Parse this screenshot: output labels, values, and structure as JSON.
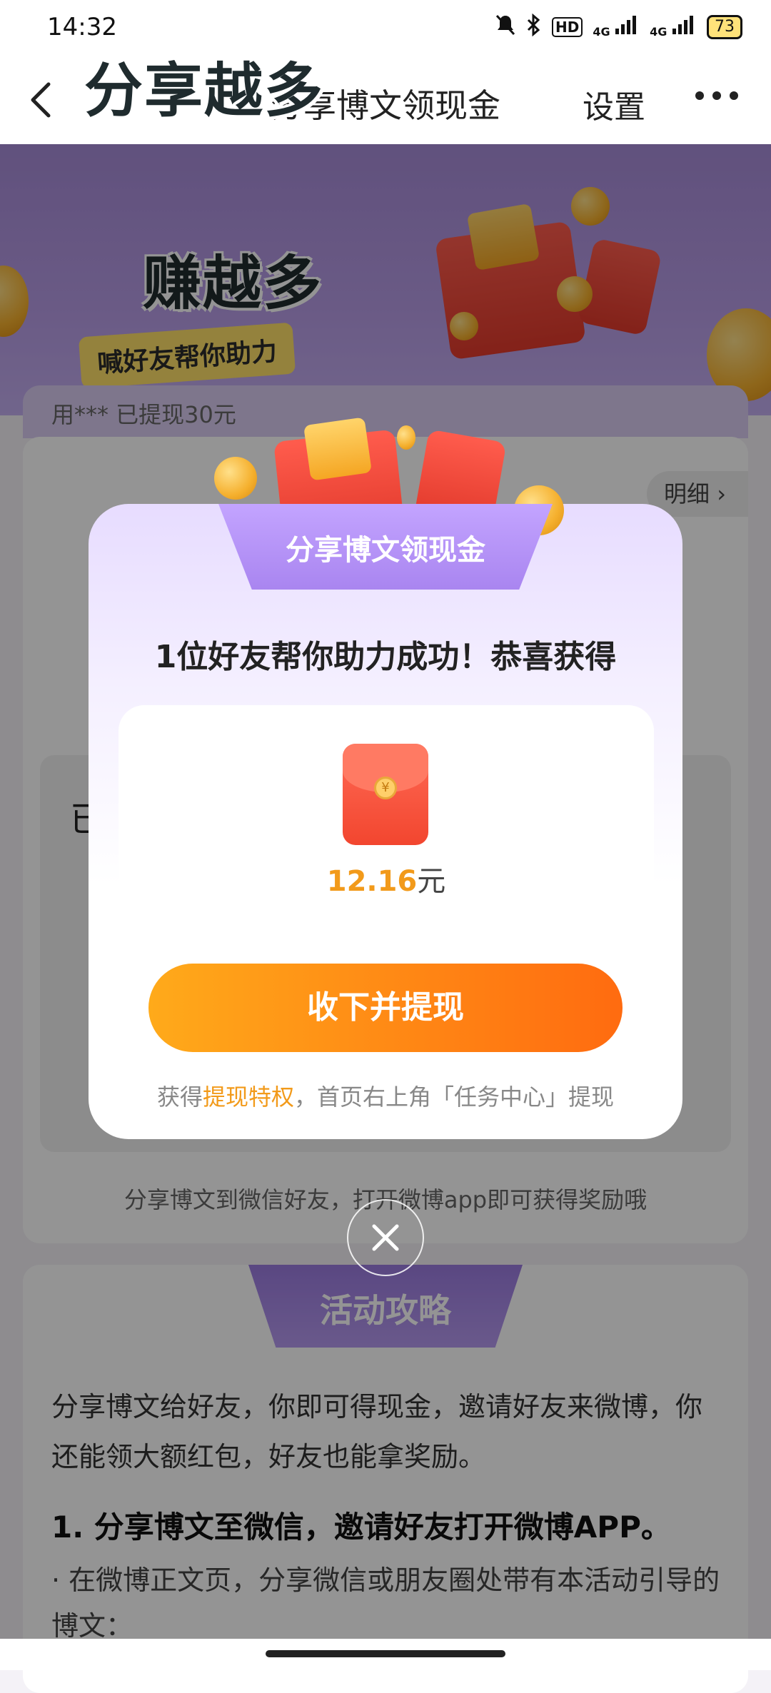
{
  "status_bar": {
    "time": "14:32",
    "hd": "HD",
    "network1": "4G",
    "network2": "4G",
    "battery": "73"
  },
  "nav": {
    "title": "分享博文领现金",
    "settings": "设置"
  },
  "banner": {
    "slogan_line1": "分享越多",
    "slogan_line2": "赚越多",
    "tag": "喊好友帮你助力"
  },
  "info_strip": {
    "text": "用*** 已提现30元"
  },
  "detail_button": "明细",
  "inner_card_label": "已",
  "footer_note": "分享博文到微信好友，打开微博app即可获得奖励哦",
  "guide": {
    "title": "活动攻略",
    "intro": "分享博文给好友，你即可得现金，邀请好友来微博，你还能领大额红包，好友也能拿奖励。",
    "step1": "1. 分享博文至微信，邀请好友打开微博APP。",
    "bullet1": "· 在微博正文页，分享微信或朋友圈处带有本活动引导的博文："
  },
  "dialog": {
    "tab_title": "分享博文领现金",
    "message": "1位好友帮你助力成功！恭喜获得",
    "amount": "12.16",
    "unit": "元",
    "cta": "收下并提现",
    "tip_prefix": "获得",
    "tip_highlight": "提现特权",
    "tip_suffix": "，首页右上角「任务中心」提现"
  },
  "colors": {
    "accent_orange": "#f29a1a",
    "purple": "#a985f0",
    "red_packet": "#f2462f"
  }
}
